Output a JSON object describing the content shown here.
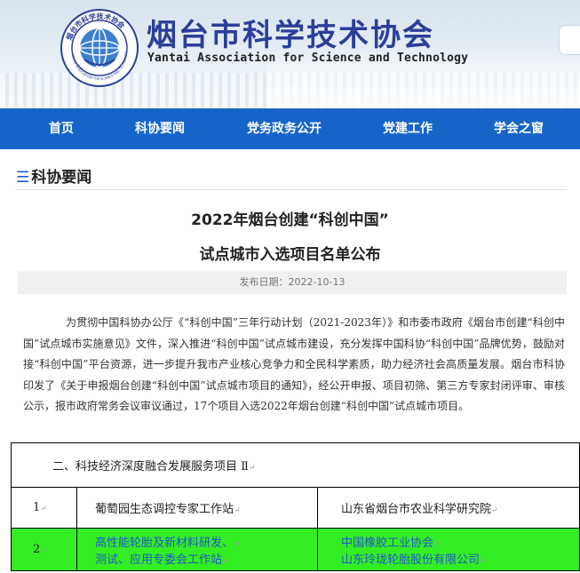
{
  "header": {
    "title": "烟台市科学技术协会",
    "subtitle": "Yantai Association for Science and Technology",
    "logo_text_top": "烟台市科学技术协会",
    "logo_text_bottom": "YANTAI ASSOCIATION FOR SCIENCE AND TECHNOLOGY",
    "brand_color": "#2a3f9a"
  },
  "nav": {
    "color": "#1764c8",
    "items": [
      "首页",
      "科协要闻",
      "党务政务公开",
      "党建工作",
      "学会之窗"
    ]
  },
  "section": {
    "label": "科协要闻"
  },
  "article": {
    "title_line1": "2022年烟台创建“科创中国”",
    "title_line2": "试点城市入选项目名单公布",
    "pubdate": "发布日期：2022-10-13",
    "body": "为贯彻中国科协办公厅《“科创中国”三年行动计划（2021-2023年）》和市委市政府《烟台市创建“科创中国”试点城市实施意见》文件，深入推进“科创中国”试点城市建设，充分发挥中国科协“科创中国”品牌优势，鼓励对接“科创中国”平台资源，进一步提升我市产业核心竞争力和全民科学素质，助力经济社会高质量发展。烟台市科协印发了《关于申报烟台创建“科创中国”试点城市项目的通知》，经公开申报、项目初筛、第三方专家封闭评审、审核公示，报市政府常务会议审议通过，17个项目入选2022年烟台创建“科创中国”试点城市项目。"
  },
  "table": {
    "section_heading": "二、科技经济深度融合发展服务项目 Ⅱ",
    "rows": [
      {
        "num": "1",
        "name_line1": "葡萄园生态调控专家工作站",
        "name_line2": "",
        "org_line1": "山东省烟台市农业科学研究院",
        "org_line2": ""
      },
      {
        "num": "2",
        "name_line1": "高性能轮胎及新材料研发、",
        "name_line2": "测试、应用专委会工作站",
        "org_line1": "中国橡胶工业协会",
        "org_line2": "山东玲珑轮胎股份有限公司"
      }
    ],
    "highlight_color": "#33ee22"
  }
}
